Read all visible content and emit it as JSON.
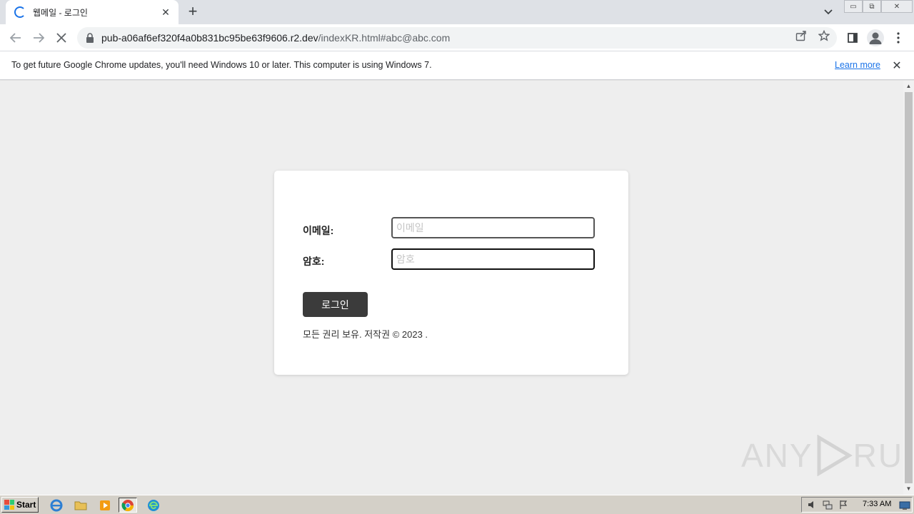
{
  "browser": {
    "tab": {
      "title": "웹메일 - 로그인",
      "close": "✕"
    },
    "new_tab": "+",
    "url": {
      "host": "pub-a06af6ef320f4a0b831bc95be63f9606.r2.dev",
      "path": "/indexKR.html#abc@abc.com"
    },
    "window_controls": {
      "minimize": "▭",
      "restore": "⧉",
      "close": "✕"
    }
  },
  "infobar": {
    "message": "To get future Google Chrome updates, you'll need Windows 10 or later. This computer is using Windows 7.",
    "link": "Learn more",
    "close": "✕"
  },
  "login": {
    "email_label": "이메일:",
    "email_placeholder": "이메일",
    "email_value": "",
    "password_label": "암호:",
    "password_placeholder": "암호",
    "password_value": "",
    "submit_label": "로그인",
    "footer": "모든 권리 보유. 저작권 © 2023 ."
  },
  "watermark": {
    "left": "ANY",
    "right": "RUN"
  },
  "taskbar": {
    "start_label": "Start",
    "clock": "7:33 AM",
    "apps": [
      "ie-icon",
      "explorer-folder-icon",
      "media-player-icon",
      "chrome-icon",
      "edge-icon"
    ]
  },
  "colors": {
    "accent": "#1a73e8",
    "button": "#3b3b3b",
    "page_bg": "#eeeeee"
  }
}
